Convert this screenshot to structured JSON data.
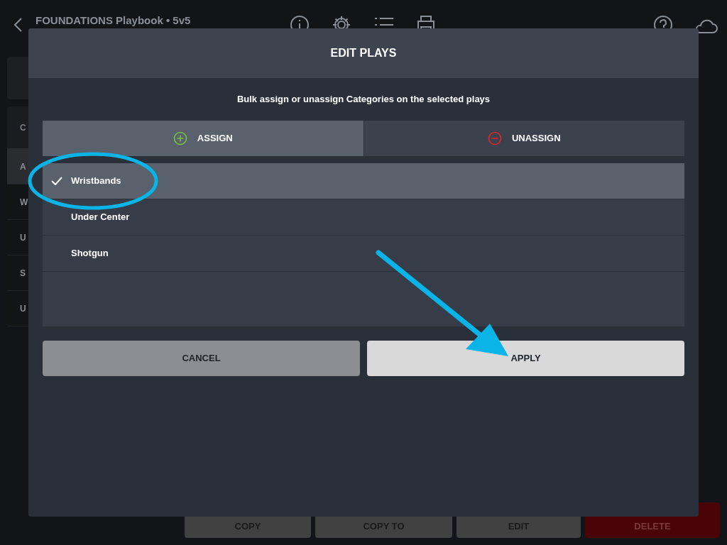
{
  "top_bar": {
    "title": "FOUNDATIONS Playbook • 5v5"
  },
  "sidebar": {
    "header": "C",
    "items": [
      {
        "label": "A",
        "selected": true
      },
      {
        "label": "W",
        "selected": false
      },
      {
        "label": "U",
        "selected": false
      },
      {
        "label": "S",
        "selected": false
      },
      {
        "label": "U",
        "selected": false
      }
    ]
  },
  "action_buttons": [
    {
      "label": "COPY",
      "kind": "normal"
    },
    {
      "label": "COPY TO",
      "kind": "normal"
    },
    {
      "label": "EDIT",
      "kind": "normal"
    },
    {
      "label": "DELETE",
      "kind": "danger"
    }
  ],
  "dialog": {
    "title": "EDIT PLAYS",
    "instruction": "Bulk assign or unassign Categories on the selected plays",
    "modes": [
      {
        "label": "ASSIGN",
        "kind": "assign",
        "selected": true
      },
      {
        "label": "UNASSIGN",
        "kind": "unassign",
        "selected": false
      }
    ],
    "categories": [
      {
        "label": "Wristbands",
        "checked": true
      },
      {
        "label": "Under Center",
        "checked": false
      },
      {
        "label": "Shotgun",
        "checked": false
      }
    ],
    "buttons": [
      {
        "label": "CANCEL",
        "kind": "cancel"
      },
      {
        "label": "APPLY",
        "kind": "apply"
      }
    ]
  }
}
